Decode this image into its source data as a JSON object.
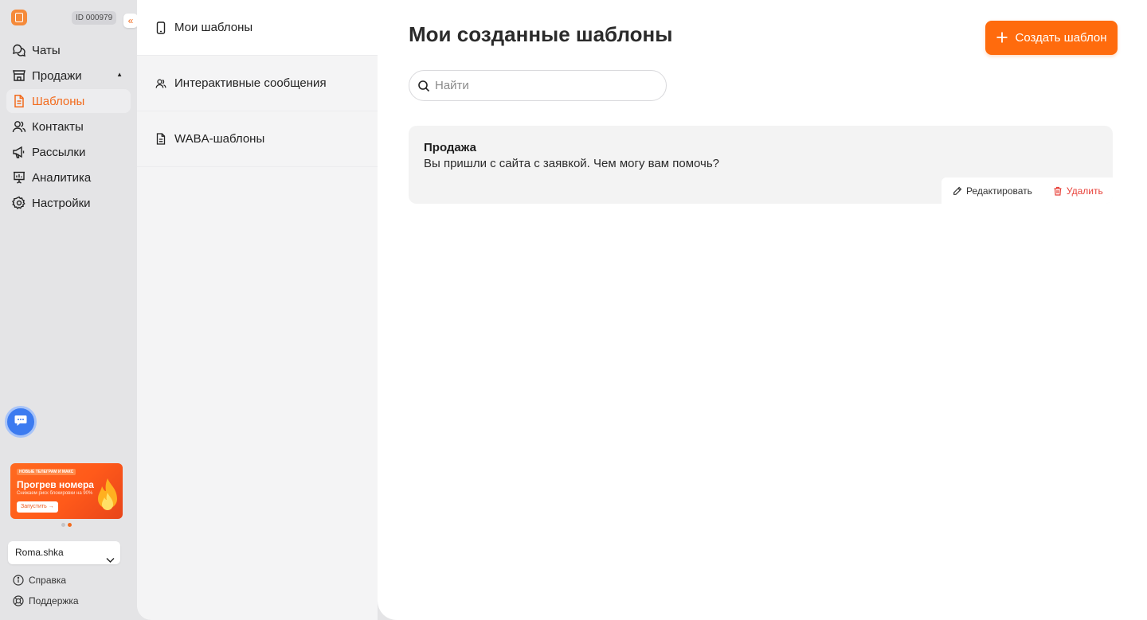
{
  "sidebar": {
    "account_id": "ID 000979",
    "collapse_glyph": "«",
    "nav": [
      {
        "label": "Чаты",
        "icon": "chats-icon"
      },
      {
        "label": "Продажи",
        "icon": "store-icon"
      },
      {
        "label": "Шаблоны",
        "icon": "document-icon",
        "active": true
      },
      {
        "label": "Контакты",
        "icon": "users-icon"
      },
      {
        "label": "Рассылки",
        "icon": "megaphone-icon"
      },
      {
        "label": "Аналитика",
        "icon": "analytics-icon"
      },
      {
        "label": "Настройки",
        "icon": "gear-icon"
      }
    ],
    "promo": {
      "tag": "НОВЫЕ ТЕЛЕГРАМ И МАКС",
      "title": "Прогрев номера",
      "subtitle": "Снижаем риск блокировки на 90%",
      "button": "Запустить →"
    },
    "account_name": "Roma.shka",
    "help": "Справка",
    "support": "Поддержка"
  },
  "templates_nav": [
    {
      "label": "Мои шаблоны",
      "icon": "phone-icon",
      "active": true
    },
    {
      "label": "Интерактивные сообщения",
      "icon": "users-icon"
    },
    {
      "label": "WABA-шаблоны",
      "icon": "document-icon"
    }
  ],
  "main": {
    "title": "Мои созданные шаблоны",
    "create_button": "Создать шаблон",
    "search_placeholder": "Найти",
    "templates": [
      {
        "name": "Продажа",
        "text": "Вы пришли с сайта с заявкой. Чем могу вам помочь?",
        "edit_label": "Редактировать",
        "delete_label": "Удалить"
      }
    ]
  },
  "colors": {
    "accent": "#ff6b0d",
    "danger": "#e8423a",
    "sidebar_bg": "#e4e4e6"
  }
}
